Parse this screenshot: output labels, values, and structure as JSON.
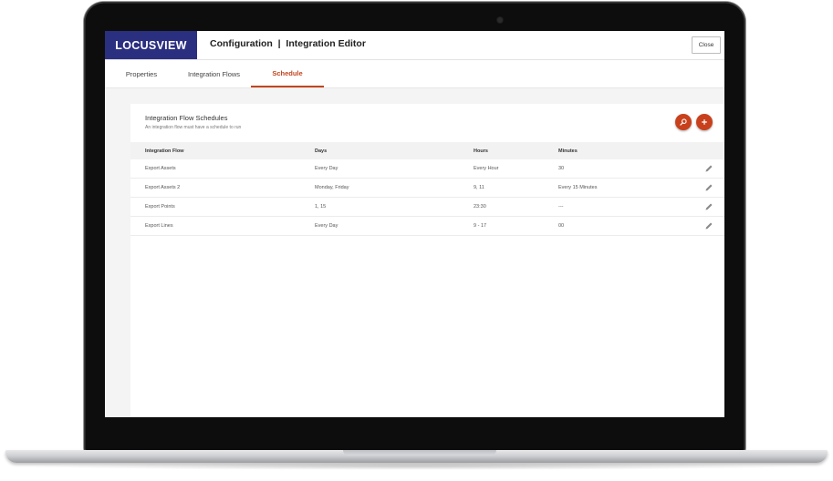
{
  "app": {
    "logo": "LOCUSVIEW",
    "title": "Configuration  |  Integration Editor",
    "close_label": "Close"
  },
  "tabs": [
    {
      "label": "Properties",
      "active": false
    },
    {
      "label": "Integration Flows",
      "active": false
    },
    {
      "label": "Schedule",
      "active": true
    }
  ],
  "panel": {
    "title": "Integration Flow Schedules",
    "subtitle": "An integration flow must have a schedule to run",
    "actions": [
      {
        "icon": "search-icon"
      },
      {
        "icon": "add-icon"
      }
    ]
  },
  "table": {
    "columns": [
      "Integration Flow",
      "Days",
      "Hours",
      "Minutes"
    ],
    "rows": [
      {
        "flow": "Export Assets",
        "days": "Every Day",
        "hours": "Every Hour",
        "minutes": "30"
      },
      {
        "flow": "Export Assets 2",
        "days": "Monday, Friday",
        "hours": "9, 11",
        "minutes": "Every 15 Minutes"
      },
      {
        "flow": "Export Points",
        "days": "1, 15",
        "hours": "23:30",
        "minutes": "---"
      },
      {
        "flow": "Export Lines",
        "days": "Every Day",
        "hours": "9 - 17",
        "minutes": "00"
      }
    ]
  },
  "colors": {
    "brand": "#2b2f7f",
    "accent": "#c2451f"
  }
}
